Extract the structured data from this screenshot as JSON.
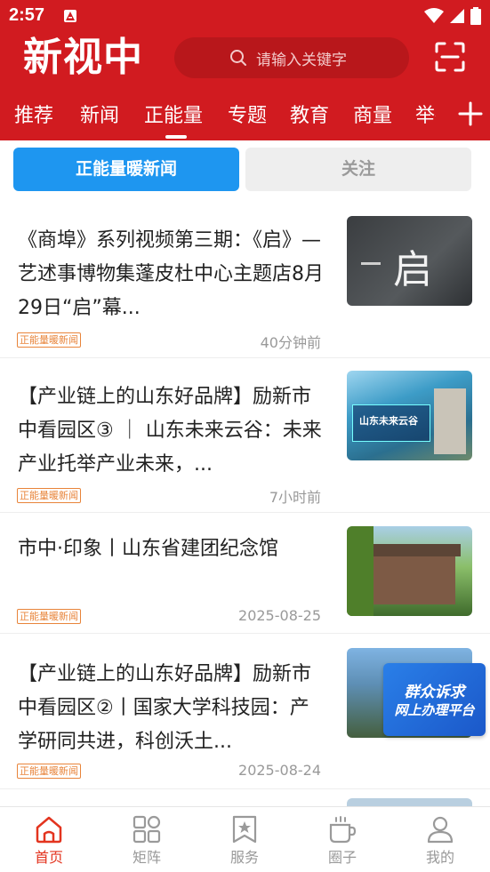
{
  "status_bar": {
    "time": "2:57"
  },
  "header": {
    "logo_text": "新视中",
    "search_placeholder": "请输入关键字"
  },
  "tabs": [
    {
      "label": "推荐"
    },
    {
      "label": "新闻"
    },
    {
      "label": "正能量",
      "active": true
    },
    {
      "label": "专题"
    },
    {
      "label": "教育"
    },
    {
      "label": "商量"
    },
    {
      "label": "举报"
    }
  ],
  "segments": [
    {
      "label": "正能量暖新闻",
      "active": true
    },
    {
      "label": "关注",
      "active": false
    }
  ],
  "news": [
    {
      "title": "《商埠》系列视频第三期：《启》—艺述事博物集蓬皮杜中心主题店8月29日“启”幕...",
      "tag": "正能量暖新闻",
      "time": "40分钟前",
      "thumb_text": "启"
    },
    {
      "title": "【产业链上的山东好品牌】励新市中看园区③ ｜ 山东未来云谷：未来产业托举产业未来，...",
      "tag": "正能量暖新闻",
      "time": "7小时前",
      "thumb_text": "山东未来云谷"
    },
    {
      "title": "市中·印象丨山东省建团纪念馆",
      "tag": "正能量暖新闻",
      "time": "2025-08-25",
      "thumb_text": ""
    },
    {
      "title": "【产业链上的山东好品牌】励新市中看园区②丨国家大学科技园：产学研同共进，科创沃土...",
      "tag": "正能量暖新闻",
      "time": "2025-08-24",
      "thumb_text": ""
    }
  ],
  "float_ad": {
    "line1": "群众诉求",
    "line2": "网上办理平台"
  },
  "bottom_nav": [
    {
      "label": "首页",
      "icon": "home-icon",
      "active": true
    },
    {
      "label": "矩阵",
      "icon": "grid-icon",
      "active": false
    },
    {
      "label": "服务",
      "icon": "star-bookmark-icon",
      "active": false
    },
    {
      "label": "圈子",
      "icon": "cup-icon",
      "active": false
    },
    {
      "label": "我的",
      "icon": "user-icon",
      "active": false
    }
  ],
  "colors": {
    "brand_red": "#d11b20",
    "accent_blue": "#1e96f0",
    "tag_orange": "#e8843a",
    "nav_active": "#e3341f"
  }
}
